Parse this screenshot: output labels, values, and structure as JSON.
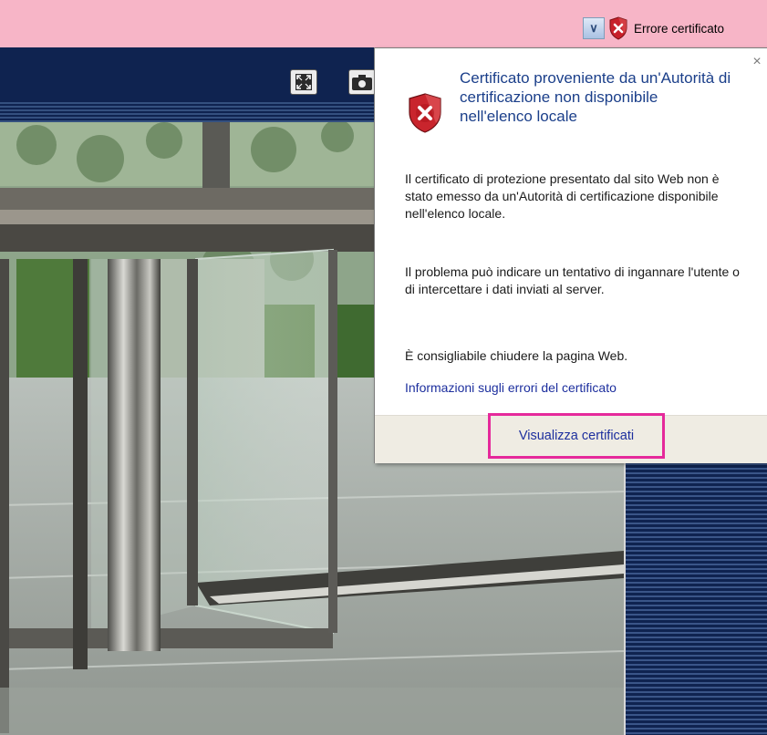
{
  "addressbar": {
    "cert_error_label": "Errore certificato",
    "dropdown_glyph": "∨"
  },
  "popup": {
    "title": "Certificato proveniente da un'Autorità di certificazione non disponibile nell'elenco locale",
    "paragraph1": "Il certificato di protezione presentato dal sito Web non è stato emesso da un'Autorità di certificazione disponibile nell'elenco locale.",
    "paragraph2": "Il problema può indicare un tentativo di ingannare l'utente o di intercettare i dati inviati al server.",
    "paragraph3": "È consigliabile chiudere la pagina Web.",
    "link": "Informazioni sugli errori del certificato",
    "view_button": "Visualizza certificati",
    "close_glyph": "×"
  },
  "icons": {
    "shield": "shield-error-icon",
    "fullscreen": "fullscreen-icon",
    "camera": "camera-icon"
  },
  "colors": {
    "addressbar_bg": "#f7b5c7",
    "header_bg": "#0f2350",
    "title_blue": "#1b3f8a",
    "highlight_border": "#e5299b"
  }
}
